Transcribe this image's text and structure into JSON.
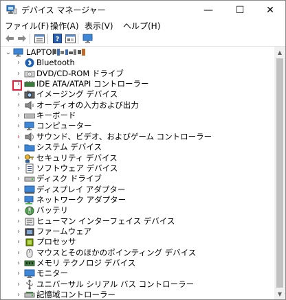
{
  "window": {
    "title": "デバイス マネージャー",
    "minimize_glyph": "—",
    "maximize_glyph": "☐",
    "close_glyph": "✕"
  },
  "menu": [
    "ファイル(F)",
    "操作(A)",
    "表示(V)",
    "ヘルプ(H)"
  ],
  "toolbar": {
    "icons": [
      "back-arrow-icon",
      "forward-arrow-icon",
      "properties-icon",
      "help-icon",
      "show-hidden-icon",
      "monitor-icon"
    ]
  },
  "tree": {
    "root": {
      "label": "LAPTOP",
      "expanded": true
    },
    "categories": [
      {
        "label": "Bluetooth",
        "icon": "bluetooth-icon"
      },
      {
        "label": "DVD/CD-ROM ドライブ",
        "icon": "dvd-drive-icon"
      },
      {
        "label": "IDE ATA/ATAPI コントローラー",
        "icon": "ide-controller-icon"
      },
      {
        "label": "イメージング デバイス",
        "icon": "camera-icon"
      },
      {
        "label": "オーディオの入力および出力",
        "icon": "speaker-icon"
      },
      {
        "label": "キーボード",
        "icon": "keyboard-icon"
      },
      {
        "label": "コンピューター",
        "icon": "computer-icon"
      },
      {
        "label": "サウンド、ビデオ、およびゲーム コントローラー",
        "icon": "sound-icon",
        "highlighted": true
      },
      {
        "label": "システム デバイス",
        "icon": "system-folder-icon"
      },
      {
        "label": "セキュリティ デバイス",
        "icon": "security-key-icon"
      },
      {
        "label": "ソフトウェア デバイス",
        "icon": "software-device-icon"
      },
      {
        "label": "ディスク ドライブ",
        "icon": "disk-drive-icon"
      },
      {
        "label": "ディスプレイ アダプター",
        "icon": "display-adapter-icon"
      },
      {
        "label": "ネットワーク アダプター",
        "icon": "network-adapter-icon"
      },
      {
        "label": "バッテリ",
        "icon": "battery-icon"
      },
      {
        "label": "ヒューマン インターフェイス デバイス",
        "icon": "hid-icon"
      },
      {
        "label": "ファームウェア",
        "icon": "firmware-icon"
      },
      {
        "label": "プロセッサ",
        "icon": "processor-icon"
      },
      {
        "label": "マウスとそのほかのポインティング デバイス",
        "icon": "mouse-icon"
      },
      {
        "label": "メモリ テクノロジ デバイス",
        "icon": "memory-icon"
      },
      {
        "label": "モニター",
        "icon": "monitor-icon"
      },
      {
        "label": "ユニバーサル シリアル バス コントローラー",
        "icon": "usb-icon"
      },
      {
        "label": "記憶域コントローラー",
        "icon": "storage-controller-icon"
      }
    ]
  },
  "colors": {
    "highlight": "#e0203a",
    "selection": "#cce8ff",
    "accent": "#1e72c8"
  },
  "glyphs": {
    "expand": "›",
    "collapse": "⌄",
    "scroll_up": "▲",
    "scroll_down": "▼"
  }
}
